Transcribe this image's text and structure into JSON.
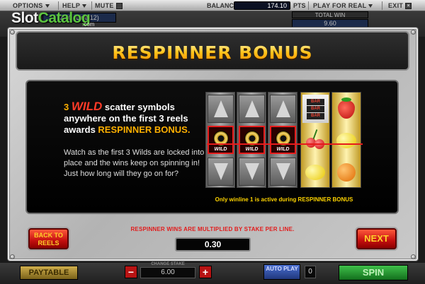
{
  "topbar": {
    "options": "OPTIONS",
    "help": "HELP",
    "mute": "MUTE",
    "balance_label": "BALANCE",
    "balance_value": "174.10",
    "balance_unit": "PTS",
    "play_for_real": "PLAY FOR REAL",
    "exit": "EXIT"
  },
  "watermark": {
    "slot": "Slot",
    "catalog": "Catalog",
    "com": ".com"
  },
  "background": {
    "line_bet": "2.40 (Line 12)",
    "total_win_label": "TOTAL WIN",
    "total_win_value": "9.60",
    "paytable": "PAYTABLE",
    "stake_label": "CHANGE STAKE",
    "stake_value": "6.00",
    "minus": "−",
    "plus": "+",
    "autoplay": "AUTO PLAY",
    "autoplay_count": "0",
    "spin": "SPIN"
  },
  "dialog": {
    "title": "RESPINNER BONUS",
    "intro_num": "3",
    "intro_wild": "WILD",
    "intro_rest1": " scatter symbols anywhere on the first 3 reels awards ",
    "intro_bonus": "RESPINNER BONUS.",
    "body": "Watch as the first 3 Wilds are locked into place and the wins keep on spinning in! Just how long will they go on for?",
    "reel_note": "Only winline 1 is active during RESPINNER BONUS",
    "wild_symbol_label": "WILD",
    "bar_label": "BAR",
    "multiplier_note": "RESPINNER WINS ARE MULTIPLIED BY STAKE PER LINE.",
    "stake_per_line": "0.30",
    "back_button": "BACK TO REELS",
    "next_button": "NEXT"
  },
  "colors": {
    "title_gold": "#ffc21a",
    "wild_red": "#ff3b28",
    "bonus_orange": "#ffb000",
    "button_red": "#c40f0f",
    "note_yellow": "#ffd400"
  }
}
